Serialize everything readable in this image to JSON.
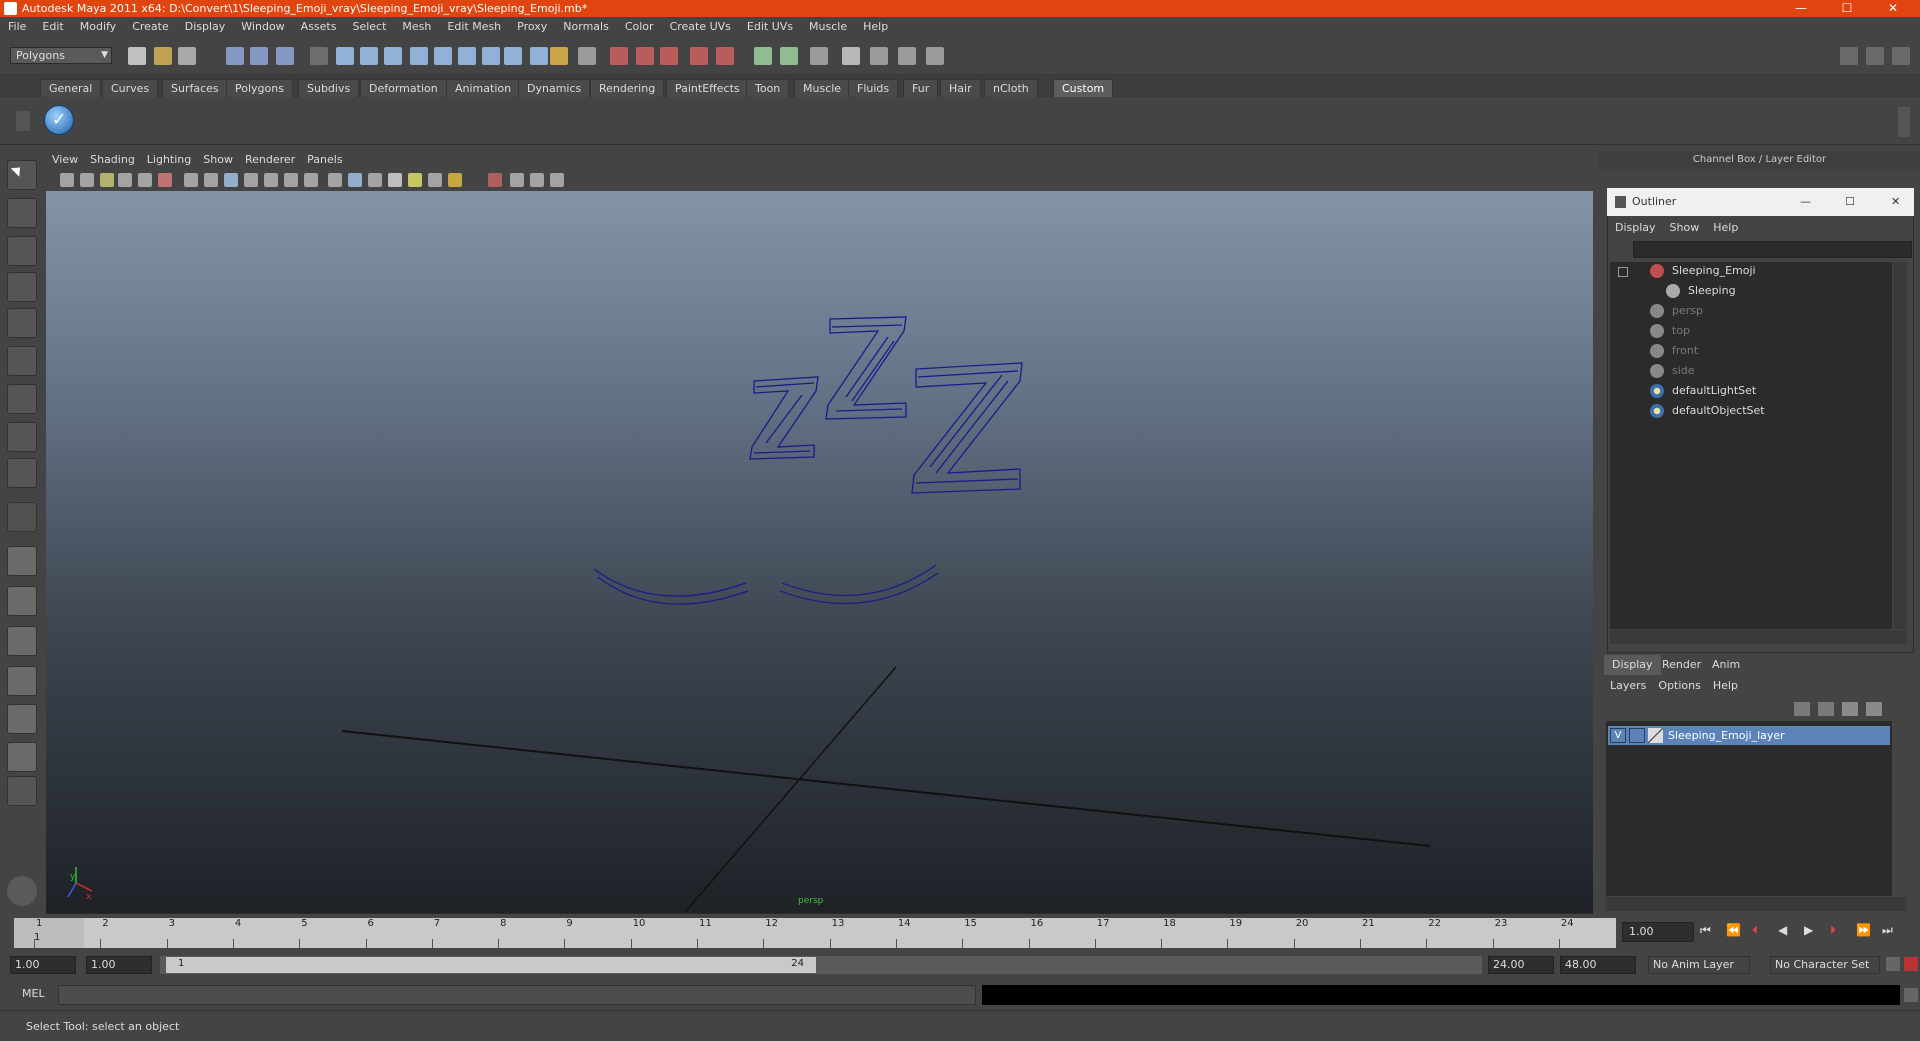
{
  "window": {
    "title": "Autodesk Maya 2011 x64: D:\\Convert\\1\\Sleeping_Emoji_vray\\Sleeping_Emoji_vray\\Sleeping_Emoji.mb*",
    "controls": {
      "minimize": "—",
      "maximize": "☐",
      "close": "✕"
    }
  },
  "menubar": [
    "File",
    "Edit",
    "Modify",
    "Create",
    "Display",
    "Window",
    "Assets",
    "Select",
    "Mesh",
    "Edit Mesh",
    "Proxy",
    "Normals",
    "Color",
    "Create UVs",
    "Edit UVs",
    "Muscle",
    "Help"
  ],
  "mode_selector": {
    "value": "Polygons"
  },
  "shelf_tabs": [
    "General",
    "Curves",
    "Surfaces",
    "Polygons",
    "Subdivs",
    "Deformation",
    "Animation",
    "Dynamics",
    "Rendering",
    "PaintEffects",
    "Toon",
    "Muscle",
    "Fluids",
    "Fur",
    "Hair",
    "nCloth",
    "Custom"
  ],
  "shelf_active": "Custom",
  "viewport": {
    "menu": [
      "View",
      "Shading",
      "Lighting",
      "Show",
      "Renderer",
      "Panels"
    ],
    "camera_label": "persp",
    "axis": {
      "x": "x",
      "y": "y"
    }
  },
  "channel_box": {
    "title": "Channel Box / Layer Editor"
  },
  "outliner": {
    "title": "Outliner",
    "menu": [
      "Display",
      "Show",
      "Help"
    ],
    "items": [
      {
        "label": "Sleeping_Emoji",
        "dim": false,
        "icon": "transform-icon"
      },
      {
        "label": "Sleeping",
        "dim": false,
        "icon": "mesh-icon"
      },
      {
        "label": "persp",
        "dim": true,
        "icon": "camera-icon"
      },
      {
        "label": "top",
        "dim": true,
        "icon": "camera-icon"
      },
      {
        "label": "front",
        "dim": true,
        "icon": "camera-icon"
      },
      {
        "label": "side",
        "dim": true,
        "icon": "camera-icon"
      },
      {
        "label": "defaultLightSet",
        "dim": false,
        "icon": "set-icon"
      },
      {
        "label": "defaultObjectSet",
        "dim": false,
        "icon": "set-icon"
      }
    ]
  },
  "layer_editor": {
    "tabs": [
      "Display",
      "Render",
      "Anim"
    ],
    "active_tab": "Display",
    "menu": [
      "Layers",
      "Options",
      "Help"
    ],
    "layers": [
      {
        "visible": "V",
        "name": "Sleeping_Emoji_layer"
      }
    ]
  },
  "timeline": {
    "ticks": [
      "1",
      "2",
      "3",
      "4",
      "5",
      "6",
      "7",
      "8",
      "9",
      "10",
      "11",
      "12",
      "13",
      "14",
      "15",
      "16",
      "17",
      "18",
      "19",
      "20",
      "21",
      "22",
      "23",
      "24"
    ],
    "current_frame": "1",
    "current_time_field": "1.00"
  },
  "range": {
    "start": "1.00",
    "anim_start": "1.00",
    "slider_start": "1",
    "slider_end": "24",
    "anim_end": "24.00",
    "end": "48.00",
    "anim_layer": "No Anim Layer",
    "character_set": "No Character Set"
  },
  "command_line": {
    "label": "MEL"
  },
  "status": {
    "help_text": "Select Tool: select an object"
  },
  "colors": {
    "title_bar": "#e0450f",
    "wireframe": "#1a1a8a",
    "selected_layer": "#5b83b8"
  }
}
